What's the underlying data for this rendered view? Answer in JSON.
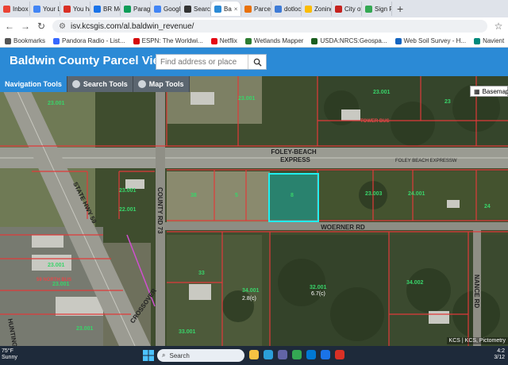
{
  "browser": {
    "tabs": [
      {
        "label": "Inbox",
        "color": "#ea4335",
        "active": false
      },
      {
        "label": "Your L",
        "color": "#4285f4",
        "active": false
      },
      {
        "label": "You ha",
        "color": "#d93025",
        "active": false
      },
      {
        "label": "BR Me",
        "color": "#1a73e8",
        "active": false
      },
      {
        "label": "Parago",
        "color": "#0f9d58",
        "active": false
      },
      {
        "label": "Googl",
        "color": "#4285f4",
        "active": false
      },
      {
        "label": "Search",
        "color": "#333333",
        "active": false
      },
      {
        "label": "Ba",
        "color": "#2b8ad6",
        "active": true
      },
      {
        "label": "Parcel",
        "color": "#e8710a",
        "active": false
      },
      {
        "label": "dotloc",
        "color": "#3e7bd6",
        "active": false
      },
      {
        "label": "Zoning",
        "color": "#fbbc04",
        "active": false
      },
      {
        "label": "City of",
        "color": "#c5221f",
        "active": false
      },
      {
        "label": "Sign Fr",
        "color": "#34a853",
        "active": false
      }
    ],
    "url": "isv.kcsgis.com/al.baldwin_revenue/",
    "bookmarks": [
      {
        "label": "Bookmarks",
        "color": "#555555"
      },
      {
        "label": "Pandora Radio - List...",
        "color": "#3668ff"
      },
      {
        "label": "ESPN: The Worldwi...",
        "color": "#d50a0a"
      },
      {
        "label": "Netflix",
        "color": "#e50914"
      },
      {
        "label": "Wetlands Mapper",
        "color": "#2e7d32"
      },
      {
        "label": "USDA:NRCS:Geospa...",
        "color": "#1b5e20"
      },
      {
        "label": "Web Soil Survey - H...",
        "color": "#1565c0"
      },
      {
        "label": "Navient",
        "color": "#00897b"
      },
      {
        "label": "Alabama Maps",
        "color": "#37474f"
      }
    ],
    "all_bookmarks": "All Bo"
  },
  "app": {
    "title": "Baldwin County Parcel Viewer",
    "search_placeholder": "Find address or place",
    "tools": [
      {
        "label": "Navigation Tools",
        "active": true
      },
      {
        "label": "Search Tools",
        "active": false
      },
      {
        "label": "Map Tools",
        "active": false
      }
    ],
    "basemaps_label": "Basemaps"
  },
  "map": {
    "roads": {
      "foley_beach_1": "FOLEY-BEACH",
      "foley_beach_2": "EXPRESS",
      "foley_beach_exp": "FOLEY BEACH EXPRESSW",
      "woerner": "WOERNER RD",
      "state_hwy": "STATE HWY 59",
      "county_rd": "COUNTY RD 73",
      "crossover": "CROSSOVER",
      "nance": "NANCE RD",
      "north_bus": "59 NORTH BUS",
      "tower_bus": "TOWER BUS",
      "huntington": "HUNTINGTON DR"
    },
    "acreage_1": "6.7(c)",
    "acreage_2": "2.8(c)",
    "attribution": "KCS | KCS, Pictometry"
  },
  "taskbar": {
    "temp": "75°F",
    "weather": "Sunny",
    "search": "Search",
    "time": "4:2",
    "date": "3/12"
  }
}
